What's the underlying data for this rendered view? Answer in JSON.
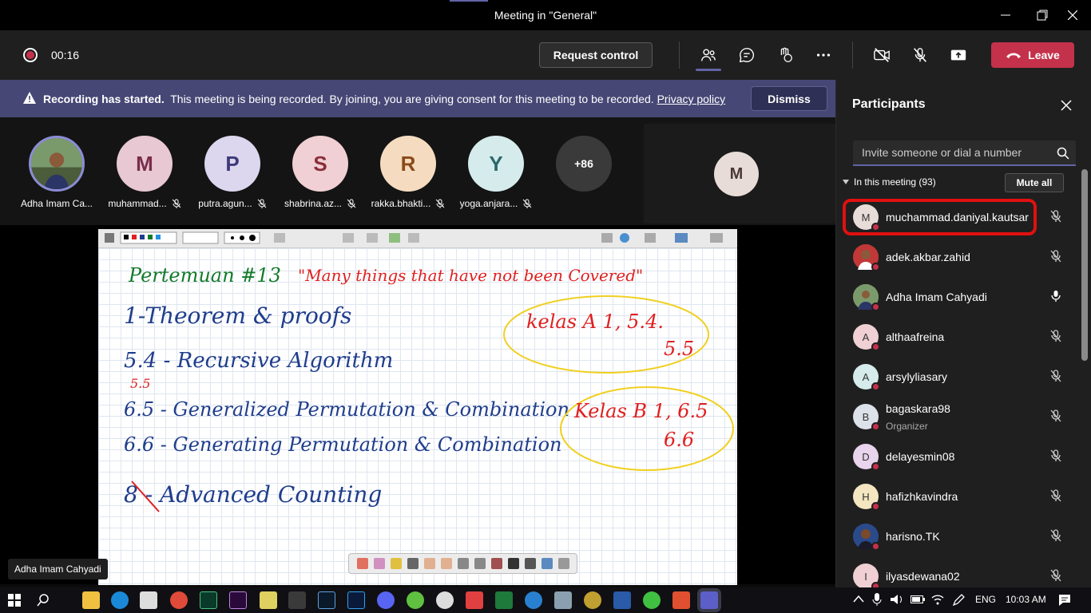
{
  "window": {
    "title": "Meeting in \"General\""
  },
  "toolbar": {
    "timer": "00:16",
    "request_control": "Request control",
    "leave": "Leave"
  },
  "banner": {
    "bold": "Recording has started.",
    "text": "This meeting is being recorded. By joining, you are giving consent for this meeting to be recorded.",
    "link": "Privacy policy",
    "dismiss": "Dismiss"
  },
  "strip": {
    "tiles": [
      {
        "initial": "",
        "name": "Adha Imam Ca..."
      },
      {
        "initial": "M",
        "name": "muhammad..."
      },
      {
        "initial": "P",
        "name": "putra.agun..."
      },
      {
        "initial": "S",
        "name": "shabrina.az..."
      },
      {
        "initial": "R",
        "name": "rakka.bhakti..."
      },
      {
        "initial": "Y",
        "name": "yoga.anjara..."
      }
    ],
    "overflow": "+86",
    "m_tile_initial": "M"
  },
  "whiteboard": {
    "line1_title": "Pertemuan #13",
    "line1_quote": "\"Many things that have not been Covered\"",
    "item1": "1-Theorem & proofs",
    "item2": "5.4 - Recursive Algorithm",
    "item2_note": "5.5",
    "item3": "6.5 - Generalized Permutation & Combination",
    "item4": "6.6 - Generating Permutation & Combination",
    "item5": "8 - Advanced Counting",
    "kelas_a": "kelas A 1, 5.4.",
    "kelas_a2": "5.5",
    "kelas_b": "Kelas B 1, 6.5",
    "kelas_b2": "6.6"
  },
  "stage": {
    "presenter": "Adha Imam Cahyadi"
  },
  "panel": {
    "title": "Participants",
    "invite_placeholder": "Invite someone or dial a number",
    "in_meeting": "In this meeting (93)",
    "mute_all": "Mute all",
    "participants": [
      {
        "initial": "M",
        "name": "muchammad.daniyal.kautsar",
        "role": "",
        "mic": "muted"
      },
      {
        "initial": "",
        "name": "adek.akbar.zahid",
        "role": "",
        "mic": "muted"
      },
      {
        "initial": "",
        "name": "Adha Imam Cahyadi",
        "role": "",
        "mic": "on"
      },
      {
        "initial": "A",
        "name": "althaafreina",
        "role": "",
        "mic": "muted"
      },
      {
        "initial": "A",
        "name": "arsylyliasary",
        "role": "",
        "mic": "muted"
      },
      {
        "initial": "B",
        "name": "bagaskara98",
        "role": "Organizer",
        "mic": "muted"
      },
      {
        "initial": "D",
        "name": "delayesmin08",
        "role": "",
        "mic": "muted"
      },
      {
        "initial": "H",
        "name": "hafizhkavindra",
        "role": "",
        "mic": "muted"
      },
      {
        "initial": "",
        "name": "harisno.TK",
        "role": "",
        "mic": "muted"
      },
      {
        "initial": "I",
        "name": "ilyasdewana02",
        "role": "",
        "mic": "muted"
      }
    ]
  },
  "taskbar": {
    "lang": "ENG",
    "time": "10:03 AM"
  },
  "colors": {
    "accent": "#6264a7",
    "leave": "#c4314b",
    "banner": "#464775",
    "highlight": "#e01010"
  }
}
